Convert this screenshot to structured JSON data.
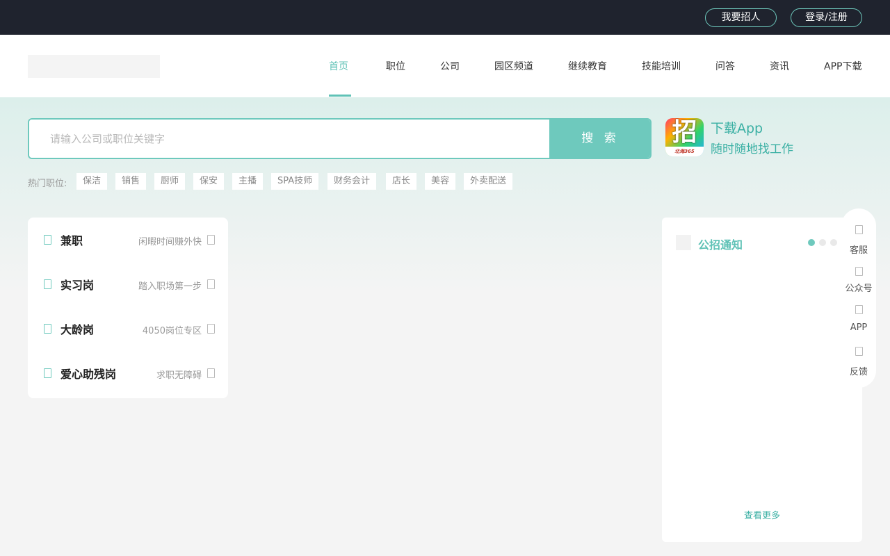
{
  "topbar": {
    "recruit_label": "我要招人",
    "login_label": "登录/注册"
  },
  "nav": {
    "items": [
      {
        "label": "首页",
        "active": true
      },
      {
        "label": "职位"
      },
      {
        "label": "公司"
      },
      {
        "label": "园区频道"
      },
      {
        "label": "继续教育"
      },
      {
        "label": "技能培训"
      },
      {
        "label": "问答"
      },
      {
        "label": "资讯"
      },
      {
        "label": "APP下载"
      }
    ]
  },
  "search": {
    "placeholder": "请输入公司或职位关键字",
    "button_label": "搜 索"
  },
  "app_promo": {
    "icon_glyph": "招",
    "icon_caption": "北海365",
    "line1": "下载App",
    "line2": "随时随地找工作"
  },
  "hot_jobs": {
    "label": "热门职位:",
    "tags": [
      "保洁",
      "销售",
      "厨师",
      "保安",
      "主播",
      "SPA技师",
      "财务会计",
      "店长",
      "美容",
      "外卖配送"
    ]
  },
  "categories": [
    {
      "title": "兼职",
      "desc": "闲暇时间赚外快"
    },
    {
      "title": "实习岗",
      "desc": "踏入职场第一步"
    },
    {
      "title": "大龄岗",
      "desc": "4050岗位专区"
    },
    {
      "title": "爱心助残岗",
      "desc": "求职无障碍"
    }
  ],
  "notice": {
    "title": "公招通知",
    "more_label": "查看更多",
    "dots_count": 3,
    "active_dot": 0
  },
  "side_toolbar": {
    "items": [
      {
        "label": "客服"
      },
      {
        "label": "公众号"
      },
      {
        "label": "APP"
      },
      {
        "label": "反馈"
      }
    ]
  },
  "colors": {
    "accent": "#6ec9bd",
    "accent_text": "#3bb0a4",
    "topbar_bg": "#1f232e"
  }
}
